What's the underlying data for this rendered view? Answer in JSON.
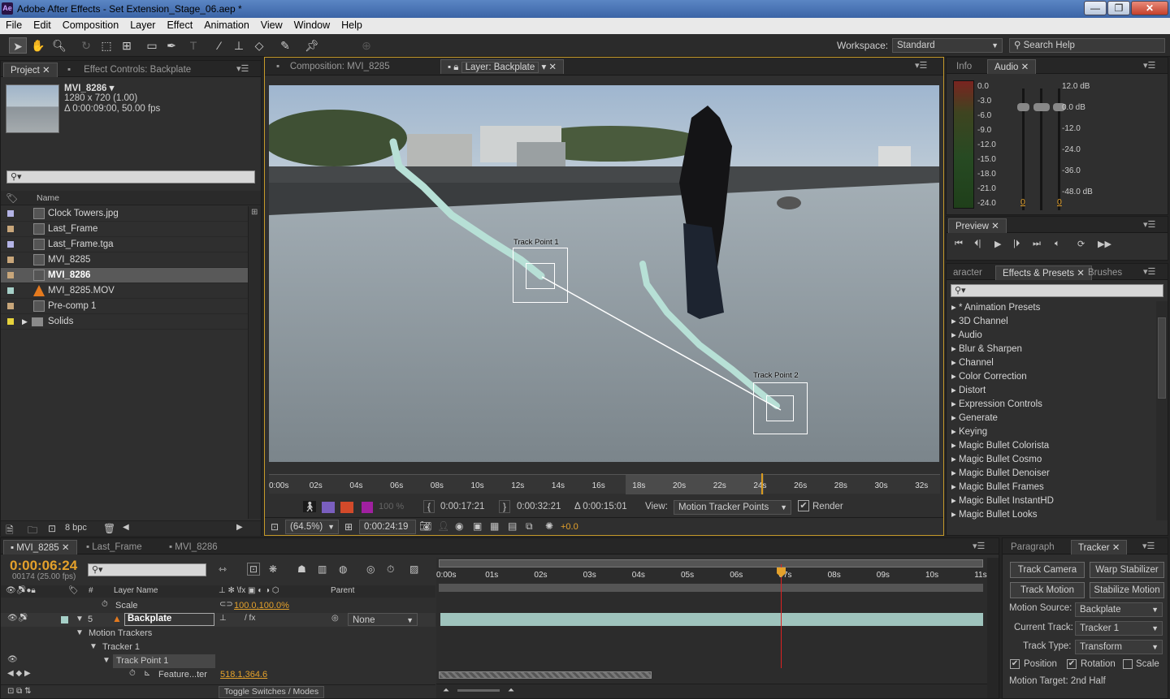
{
  "app": {
    "title": "Adobe After Effects - Set Extension_Stage_06.aep *",
    "icon_label": "Ae"
  },
  "window_controls": {
    "minimize": "—",
    "maximize": "❐",
    "close": "✕"
  },
  "menu": [
    "File",
    "Edit",
    "Composition",
    "Layer",
    "Effect",
    "Animation",
    "View",
    "Window",
    "Help"
  ],
  "workspace": {
    "label": "Workspace:",
    "value": "Standard",
    "search_placeholder": "Search Help"
  },
  "project_panel": {
    "tabs": [
      "Project",
      "Effect Controls: Backplate"
    ],
    "item_name": "MVI_8286 ▾",
    "item_size": "1280 x 720 (1.00)",
    "item_duration": "Δ 0:00:09:00, 50.00 fps",
    "name_header": "Name",
    "items": [
      {
        "name": "Clock Towers.jpg",
        "color": "#b4b4e6",
        "icon": "image-icon",
        "selected": false
      },
      {
        "name": "Last_Frame",
        "color": "#c8a67a",
        "icon": "comp-icon",
        "selected": false
      },
      {
        "name": "Last_Frame.tga",
        "color": "#b4b4e6",
        "icon": "image-icon",
        "selected": false
      },
      {
        "name": "MVI_8285",
        "color": "#c8a67a",
        "icon": "comp-icon",
        "selected": false
      },
      {
        "name": "MVI_8286",
        "color": "#c8a67a",
        "icon": "comp-icon",
        "selected": true
      },
      {
        "name": "MVI_8285.MOV",
        "color": "#a6d0c8",
        "icon": "footage-icon",
        "selected": false
      },
      {
        "name": "Pre-comp 1",
        "color": "#c8a67a",
        "icon": "comp-icon",
        "selected": false
      },
      {
        "name": "Solids",
        "color": "#e6d23c",
        "icon": "folder-icon",
        "selected": false
      }
    ],
    "bpc": "8 bpc"
  },
  "viewer": {
    "tabs": [
      "Composition: MVI_8285",
      "Layer: Backplate"
    ],
    "track_point_1": "Track Point 1",
    "track_point_2": "Track Point 2",
    "ruler": [
      "0:00s",
      "02s",
      "04s",
      "06s",
      "08s",
      "10s",
      "12s",
      "14s",
      "16s",
      "18s",
      "20s",
      "22s",
      "24s",
      "26s",
      "28s",
      "30s",
      "32s"
    ],
    "in_time": "0:00:17:21",
    "out_time": "0:00:32:21",
    "duration": "Δ 0:00:15:01",
    "view_label": "View:",
    "view_value": "Motion Tracker Points",
    "render_label": "Render",
    "zoom": "(64.5%)",
    "current_time": "0:00:24:19",
    "exposure": "+0.0",
    "opacity": "100 %"
  },
  "info_panel": {
    "tabs": [
      "Info",
      "Audio"
    ],
    "db_left": [
      "0.0",
      "-3.0",
      "-6.0",
      "-9.0",
      "-12.0",
      "-15.0",
      "-18.0",
      "-21.0",
      "-24.0"
    ],
    "db_right": [
      "12.0 dB",
      "0.0 dB",
      "-12.0",
      "-24.0",
      "-36.0",
      "-48.0 dB"
    ],
    "ch_left": "0",
    "ch_right": "0"
  },
  "preview_panel": {
    "title": "Preview"
  },
  "effects_panel": {
    "tabs": [
      "aracter",
      "Effects & Presets",
      "Brushes"
    ],
    "items": [
      "* Animation Presets",
      "3D Channel",
      "Audio",
      "Blur & Sharpen",
      "Channel",
      "Color Correction",
      "Distort",
      "Expression Controls",
      "Generate",
      "Keying",
      "Magic Bullet Colorista",
      "Magic Bullet Cosmo",
      "Magic Bullet Denoiser",
      "Magic Bullet Frames",
      "Magic Bullet InstantHD",
      "Magic Bullet Looks"
    ]
  },
  "timeline": {
    "tabs": [
      "MVI_8285",
      "Last_Frame",
      "MVI_8286"
    ],
    "timecode": "0:00:06:24",
    "frame_info": "00174 (25.00 fps)",
    "col_layer_name": "Layer Name",
    "col_num": "#",
    "col_parent": "Parent",
    "scale_label": "Scale",
    "scale_value": "100.0,100.0%",
    "layer_num": "5",
    "layer_name": "Backplate",
    "parent_value": "None",
    "motion_trackers": "Motion Trackers",
    "tracker": "Tracker 1",
    "track_point": "Track Point 1",
    "feature_label": "Feature...ter",
    "feature_value": "518.1,364.6",
    "toggle": "Toggle Switches / Modes",
    "ruler": [
      "0:00s",
      "01s",
      "02s",
      "03s",
      "04s",
      "05s",
      "06s",
      "07s",
      "08s",
      "09s",
      "10s",
      "11s"
    ]
  },
  "tracker_panel": {
    "tabs": [
      "Paragraph",
      "Tracker"
    ],
    "track_camera": "Track Camera",
    "warp_stabilizer": "Warp Stabilizer",
    "track_motion": "Track Motion",
    "stabilize_motion": "Stabilize Motion",
    "motion_source_label": "Motion Source:",
    "motion_source": "Backplate",
    "current_track_label": "Current Track:",
    "current_track": "Tracker 1",
    "track_type_label": "Track Type:",
    "track_type": "Transform",
    "position": "Position",
    "rotation": "Rotation",
    "scale": "Scale",
    "motion_target": "Motion Target: 2nd Half"
  }
}
